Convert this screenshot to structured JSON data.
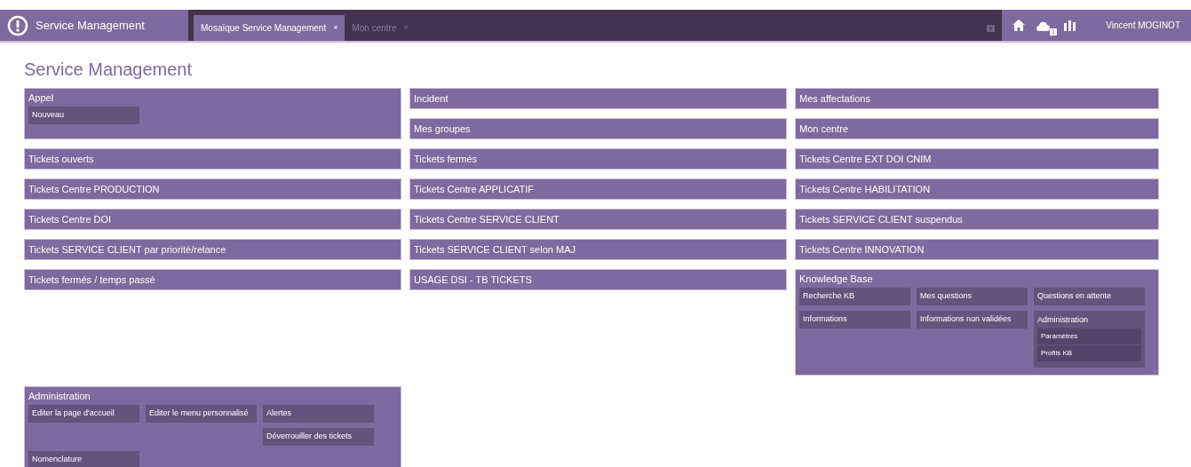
{
  "app": {
    "title": "Service Management",
    "user": "Vincent MOGINOT",
    "notification_count": "1"
  },
  "tabs": [
    {
      "label": "Mosaïque Service Management",
      "close": "×",
      "selected": true
    },
    {
      "label": "Mon centre",
      "close": "×",
      "selected": false
    }
  ],
  "page_title": "Service Management",
  "columns": [
    {
      "items": [
        {
          "kind": "group",
          "label": "Appel",
          "rows": [
            [
              {
                "kind": "link",
                "label": "Nouveau"
              }
            ]
          ]
        },
        {
          "kind": "tile",
          "label": "Tickets ouverts"
        },
        {
          "kind": "tile",
          "label": "Tickets Centre PRODUCTION"
        },
        {
          "kind": "tile",
          "label": "Tickets Centre DOI"
        },
        {
          "kind": "tile",
          "label": "Tickets SERVICE CLIENT par priorité/relance"
        },
        {
          "kind": "tile",
          "label": "Tickets fermés / temps passé"
        }
      ]
    },
    {
      "items": [
        {
          "kind": "tile",
          "label": "Incident"
        },
        {
          "kind": "tile",
          "label": "Mes groupes"
        },
        {
          "kind": "tile",
          "label": "Tickets fermés"
        },
        {
          "kind": "tile",
          "label": "Tickets Centre APPLICATIF"
        },
        {
          "kind": "tile",
          "label": "Tickets Centre SERVICE CLIENT"
        },
        {
          "kind": "tile",
          "label": "Tickets SERVICE CLIENT selon MAJ"
        },
        {
          "kind": "tile",
          "label": "USAGE DSI - TB TICKETS"
        }
      ]
    },
    {
      "items": [
        {
          "kind": "tile",
          "label": "Mes affectations"
        },
        {
          "kind": "tile",
          "label": "Mon centre"
        },
        {
          "kind": "tile",
          "label": "Tickets Centre EXT DOI CNIM"
        },
        {
          "kind": "tile",
          "label": "Tickets Centre HABILITATION"
        },
        {
          "kind": "tile",
          "label": "Tickets SERVICE CLIENT suspendus"
        },
        {
          "kind": "tile",
          "label": "Tickets Centre INNOVATION"
        },
        {
          "kind": "group",
          "label": "Knowledge Base",
          "rows": [
            [
              {
                "kind": "link",
                "label": "Recherche KB"
              },
              {
                "kind": "link",
                "label": "Mes questions"
              },
              {
                "kind": "link",
                "label": "Questions en attente"
              }
            ],
            [
              {
                "kind": "link",
                "label": "Informations"
              },
              {
                "kind": "link",
                "label": "Informations non validées"
              },
              {
                "kind": "group",
                "label": "Administration",
                "items": [
                  "Paramètres",
                  "Profils KB"
                ]
              }
            ]
          ]
        }
      ]
    }
  ],
  "bottom": [
    {
      "kind": "group",
      "label": "Administration",
      "rows": [
        [
          {
            "kind": "link",
            "label": "Editer la page d'accueil"
          },
          {
            "kind": "link",
            "label": "Editer le menu personnalisé"
          },
          {
            "kind": "stack",
            "items": [
              "Alertes",
              "Déverrouiller des tickets"
            ]
          }
        ],
        [
          {
            "kind": "link",
            "label": "Nomenclature"
          }
        ]
      ]
    }
  ]
}
